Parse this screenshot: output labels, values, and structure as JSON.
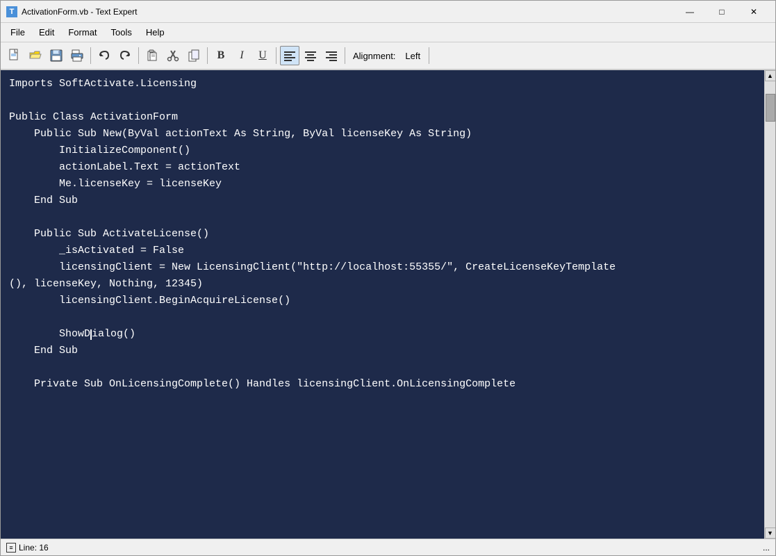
{
  "window": {
    "title": "ActivationForm.vb - Text Expert",
    "icon_label": "T"
  },
  "title_buttons": {
    "minimize": "—",
    "maximize": "□",
    "close": "✕"
  },
  "menu": {
    "items": [
      "File",
      "Edit",
      "Format",
      "Tools",
      "Help"
    ]
  },
  "toolbar": {
    "bold_label": "B",
    "italic_label": "I",
    "underline_label": "U",
    "alignment_text": "Alignment:",
    "alignment_value": "Left"
  },
  "code": {
    "lines": [
      "Imports SoftActivate.Licensing",
      "",
      "Public Class ActivationForm",
      "    Public Sub New(ByVal actionText As String, ByVal licenseKey As String)",
      "        InitializeComponent()",
      "        actionLabel.Text = actionText",
      "        Me.licenseKey = licenseKey",
      "    End Sub",
      "",
      "    Public Sub ActivateLicense()",
      "        _isActivated = False",
      "        licensingClient = New LicensingClient(\"http://localhost:55355/\", CreateLicenseKeyTemplate",
      "(), licenseKey, Nothing, 12345)",
      "        licensingClient.BeginAcquireLicense()",
      "",
      "        ShowDialog()",
      "    End Sub",
      "",
      "    Private Sub OnLicensingComplete() Handles licensingClient.OnLicensingComplete"
    ],
    "cursor_line": 16,
    "cursor_col": 14
  },
  "status": {
    "line_label": "Line: 16"
  }
}
